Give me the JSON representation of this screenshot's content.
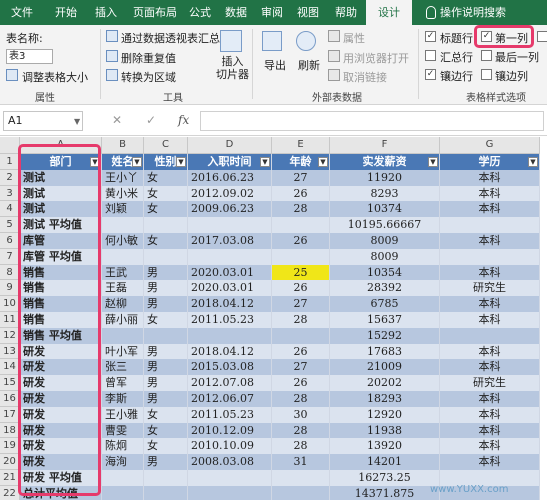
{
  "ribbon_tabs": [
    "文件",
    "开始",
    "插入",
    "页面布局",
    "公式",
    "数据",
    "审阅",
    "视图",
    "帮助",
    "设计",
    "操作说明搜索"
  ],
  "active_tab": "设计",
  "ribbon": {
    "table_name_label": "表名称:",
    "table_name_value": "表3",
    "resize_table": "调整表格大小",
    "group_properties": "属性",
    "summarize_pivot": "通过数据透视表汇总",
    "remove_duplicates": "删除重复值",
    "convert_range": "转换为区域",
    "insert_slicer": "插入\n切片器",
    "group_tools": "工具",
    "export": "导出",
    "refresh": "刷新",
    "properties": "属性",
    "open_in_browser": "用浏览器打开",
    "unlink": "取消链接",
    "group_external": "外部表数据",
    "header_row": "标题行",
    "first_column": "第一列",
    "total_row": "汇总行",
    "last_column": "最后一列",
    "banded_rows": "镶边行",
    "banded_columns": "镶边列",
    "group_style_options": "表格样式选项"
  },
  "formula_bar": {
    "cell_ref": "A1",
    "cancel": "✕",
    "enter": "✓",
    "fx": "fx",
    "content": ""
  },
  "columns": [
    "A",
    "B",
    "C",
    "D",
    "E",
    "F",
    "G"
  ],
  "headers": [
    "部门",
    "姓名",
    "性别",
    "入职时间",
    "年龄",
    "实发薪资",
    "学历"
  ],
  "rows": [
    [
      "测试",
      "王小丫",
      "女",
      "2016.06.23",
      "27",
      "11920",
      "本科"
    ],
    [
      "测试",
      "黄小米",
      "女",
      "2012.09.02",
      "26",
      "8293",
      "本科"
    ],
    [
      "测试",
      "刘颖",
      "女",
      "2009.06.23",
      "28",
      "10374",
      "本科"
    ],
    [
      "测试 平均值",
      "",
      "",
      "",
      "",
      "10195.66667",
      ""
    ],
    [
      "库管",
      "何小敏",
      "女",
      "2017.03.08",
      "26",
      "8009",
      "本科"
    ],
    [
      "库管 平均值",
      "",
      "",
      "",
      "",
      "8009",
      ""
    ],
    [
      "销售",
      "王武",
      "男",
      "2020.03.01",
      "25",
      "10354",
      "本科"
    ],
    [
      "销售",
      "王磊",
      "男",
      "2020.03.01",
      "26",
      "28392",
      "研究生"
    ],
    [
      "销售",
      "赵柳",
      "男",
      "2018.04.12",
      "27",
      "6785",
      "本科"
    ],
    [
      "销售",
      "薛小丽",
      "女",
      "2011.05.23",
      "28",
      "15637",
      "本科"
    ],
    [
      "销售 平均值",
      "",
      "",
      "",
      "",
      "15292",
      ""
    ],
    [
      "研发",
      "叶小军",
      "男",
      "2018.04.12",
      "26",
      "17683",
      "本科"
    ],
    [
      "研发",
      "张三",
      "男",
      "2015.03.08",
      "27",
      "21009",
      "本科"
    ],
    [
      "研发",
      "曾军",
      "男",
      "2012.07.08",
      "26",
      "20202",
      "研究生"
    ],
    [
      "研发",
      "李斯",
      "男",
      "2012.06.07",
      "28",
      "18293",
      "本科"
    ],
    [
      "研发",
      "王小雅",
      "女",
      "2011.05.23",
      "30",
      "12920",
      "本科"
    ],
    [
      "研发",
      "曹雯",
      "女",
      "2010.12.09",
      "28",
      "11938",
      "本科"
    ],
    [
      "研发",
      "陈炯",
      "女",
      "2010.10.09",
      "28",
      "13920",
      "本科"
    ],
    [
      "研发",
      "海洵",
      "男",
      "2008.03.08",
      "31",
      "14201",
      "本科"
    ],
    [
      "研发 平均值",
      "",
      "",
      "",
      "",
      "16273.25",
      ""
    ],
    [
      "总计平均值",
      "",
      "",
      "",
      "",
      "14371.875",
      ""
    ]
  ],
  "highlight_cell": {
    "row": 7,
    "col": 4
  },
  "watermark": "www.YUXX.com",
  "colors": {
    "ribbon_green": "#217346",
    "header_blue": "#4a78b5",
    "band_a": "#b7c7df",
    "band_b": "#dbe3ef",
    "highlight": "#f0e618",
    "annotation_pink": "#e63a6b"
  }
}
